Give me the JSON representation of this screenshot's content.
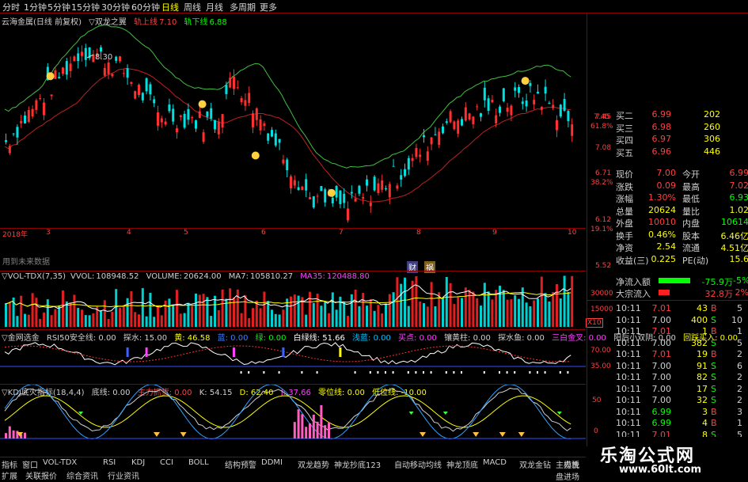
{
  "toolbar": {
    "items": [
      "分时",
      "1分钟",
      "5分钟",
      "15分钟",
      "30分钟",
      "60分钟",
      "日线",
      "周线",
      "月线",
      "多周期",
      "更多"
    ]
  },
  "main": {
    "stock_label": "云海金属(日线 前复权)",
    "indicator_name": "▽双龙之翼",
    "upper_label": "轨上线",
    "upper_value": "7.10",
    "lower_label": "轨下线",
    "lower_value": "6.88",
    "high_marker": "8.30",
    "note_text": "用到未来数据",
    "event_tag1": "财",
    "event_tag2": "祸",
    "price_axis": [
      "7.45",
      "61.8%",
      "7.08",
      "6.71",
      "38.2%",
      "6.12",
      "19.1%",
      "5.52"
    ]
  },
  "x_axis": {
    "labels": [
      "2018年",
      "3",
      "4",
      "5",
      "6",
      "7",
      "8",
      "9",
      "10"
    ]
  },
  "vol": {
    "name": "▽VOL-TDX(7,35)",
    "vvol_label": "VVOL:",
    "vvol": "108948.52",
    "volume_label": "VOLUME:",
    "volume": "20624.00",
    "ma7_label": "MA7:",
    "ma7": "105810.27",
    "ma35_label": "MA35:",
    "ma35": "120488.80",
    "axis": [
      "30000",
      "15000",
      "X10"
    ]
  },
  "rsi": {
    "name": "▽金网选金",
    "items": [
      "RSI50安全线: 0.00",
      "探水: 15.00",
      "黄: 46.58",
      "蓝: 0.00",
      "绿: 0.00",
      "白绿线: 51.66",
      "浅蓝: 0.00",
      "买点: 0.00",
      "镶黄柱: 0.00",
      "探水鱼: 0.00",
      "三白金叉: 0.00",
      "阳后小双阴: 0.00",
      "回踩买入: 0.00"
    ],
    "axis": [
      "70.00",
      "35.00"
    ]
  },
  "kdj": {
    "name": "▽KDJ底火指标(18,4,4)",
    "items": [
      "底线: 0.00",
      "主力抓货: 0.00",
      "K: 54.15",
      "D: 62.40",
      "J: 37.66",
      "零位线: 0.00",
      "低位线: -10.00"
    ],
    "axis": [
      "50",
      "0"
    ]
  },
  "quote": {
    "book": [
      {
        "label": "买二",
        "price": "6.99",
        "vol": "202"
      },
      {
        "label": "买三",
        "price": "6.98",
        "vol": "260"
      },
      {
        "label": "买四",
        "price": "6.97",
        "vol": "306"
      },
      {
        "label": "买五",
        "price": "6.96",
        "vol": "446"
      }
    ],
    "stats": [
      {
        "l1": "现价",
        "v1": "7.00",
        "l2": "今开",
        "v2": "6.99"
      },
      {
        "l1": "涨跌",
        "v1": "0.09",
        "l2": "最高",
        "v2": "7.02"
      },
      {
        "l1": "涨幅",
        "v1": "1.30%",
        "l2": "最低",
        "v2": "6.93"
      },
      {
        "l1": "总量",
        "v1": "20624",
        "l2": "量比",
        "v2": "1.02"
      },
      {
        "l1": "外盘",
        "v1": "10010",
        "l2": "内盘",
        "v2": "10614"
      },
      {
        "l1": "换手",
        "v1": "0.46%",
        "l2": "股本",
        "v2": "6.46亿"
      },
      {
        "l1": "净资",
        "v1": "2.54",
        "l2": "流通",
        "v2": "4.51亿"
      },
      {
        "l1": "收益(三)",
        "v1": "0.225",
        "l2": "PE(动)",
        "v2": "15.6"
      }
    ],
    "flow": [
      {
        "label": "净流入额",
        "value": "-75.9万",
        "pct": "-5%"
      },
      {
        "label": "大宗流入",
        "value": "32.8万",
        "pct": "2%"
      }
    ],
    "ticks": [
      {
        "t": "10:11",
        "p": "7.01",
        "v": "43",
        "s": "B",
        "n": "5"
      },
      {
        "t": "10:11",
        "p": "7.00",
        "v": "400",
        "s": "S",
        "n": "10"
      },
      {
        "t": "10:11",
        "p": "7.01",
        "v": "1",
        "s": "B",
        "n": "1"
      },
      {
        "t": "10:11",
        "p": "7.00",
        "v": "382",
        "s": "S",
        "n": "5"
      },
      {
        "t": "10:11",
        "p": "7.01",
        "v": "19",
        "s": "B",
        "n": "2"
      },
      {
        "t": "10:11",
        "p": "7.00",
        "v": "91",
        "s": "S",
        "n": "6"
      },
      {
        "t": "10:11",
        "p": "7.00",
        "v": "82",
        "s": "S",
        "n": "2"
      },
      {
        "t": "10:11",
        "p": "7.00",
        "v": "17",
        "s": "S",
        "n": "2"
      },
      {
        "t": "10:11",
        "p": "7.00",
        "v": "32",
        "s": "S",
        "n": "2"
      },
      {
        "t": "10:11",
        "p": "6.99",
        "v": "3",
        "s": "B",
        "n": "3"
      },
      {
        "t": "10:11",
        "p": "6.99",
        "v": "4",
        "s": "B",
        "n": "1"
      },
      {
        "t": "10:11",
        "p": "7.01",
        "v": "8",
        "s": "S",
        "n": "5"
      },
      {
        "t": "10:11",
        "p": "7.02",
        "v": "1",
        "s": "B",
        "n": "1"
      },
      {
        "t": "10:11",
        "p": "7.02",
        "v": "22",
        "s": "B",
        "n": "4"
      }
    ]
  },
  "tabs": {
    "row1": [
      "指标",
      "窗口",
      "VOL-TDX",
      "RSI",
      "KDJ",
      "CCI",
      "BOLL",
      "结构预警",
      "DDMI",
      "双龙趋势",
      "神龙抄底123",
      "自动移动均线",
      "神龙顶底",
      "MACD",
      "双龙金钻",
      "主力洗盘进场",
      "更多",
      "模板"
    ],
    "row2": [
      "扩展",
      "关联报价",
      "综合资讯",
      "行业资讯"
    ]
  },
  "watermark": {
    "line1": "乐淘公式网",
    "line2": "www.60lt.com"
  },
  "colors": {
    "up": "#ff3030",
    "down": "#00ffff",
    "grid": "#8b0000",
    "yellow": "#ffff00",
    "green": "#00ff00"
  }
}
